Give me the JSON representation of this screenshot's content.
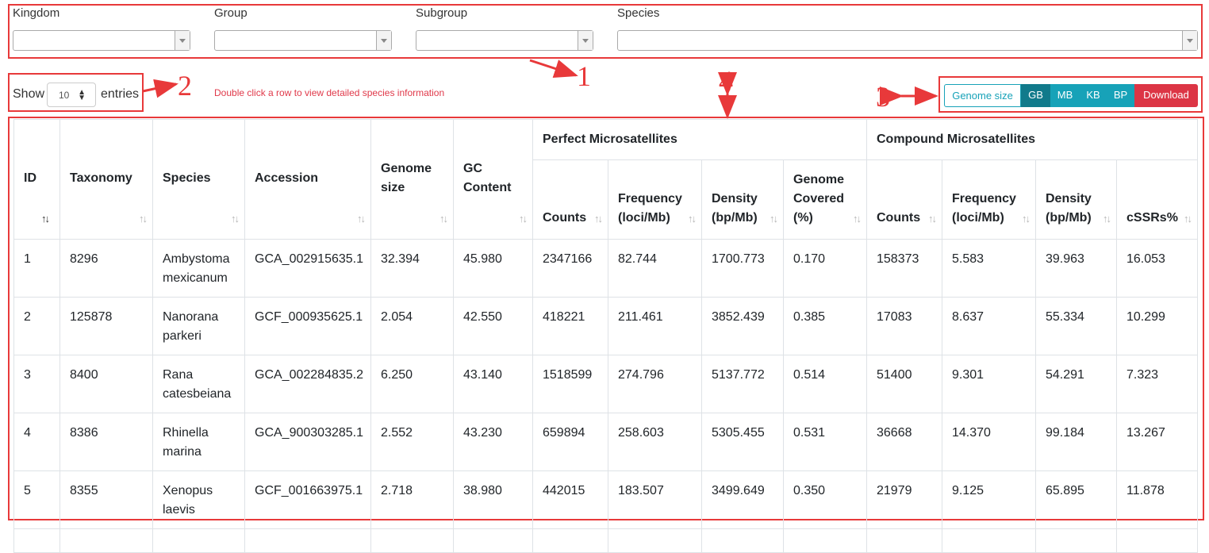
{
  "filters": {
    "kingdom_label": "Kingdom",
    "group_label": "Group",
    "subgroup_label": "Subgroup",
    "species_label": "Species"
  },
  "annotations": {
    "a1": "1",
    "a2": "2",
    "a3": "3",
    "a4": "4"
  },
  "length": {
    "show": "Show",
    "value": "10",
    "entries": "entries"
  },
  "hint": "Double click a row to view detailed species information",
  "buttons": {
    "genome_size": "Genome size",
    "gb": "GB",
    "mb": "MB",
    "kb": "KB",
    "bp": "BP",
    "download": "Download"
  },
  "table": {
    "headers": {
      "id": "ID",
      "taxonomy": "Taxonomy",
      "species": "Species",
      "accession": "Accession",
      "genome_size_1": "Genome",
      "genome_size_2": "size",
      "gc_1": "GC",
      "gc_2": "Content",
      "perfect": "Perfect Microsatellites",
      "compound": "Compound Microsatellites",
      "counts": "Counts",
      "freq_1": "Frequency",
      "freq_2": "(loci/Mb)",
      "density_1": "Density",
      "density_2": "(bp/Mb)",
      "covered_1": "Genome",
      "covered_2": "Covered",
      "covered_3": "(%)",
      "cssrs": "cSSRs%"
    },
    "rows": [
      {
        "id": "1",
        "taxonomy": "8296",
        "species_1": "Ambystoma",
        "species_2": "mexicanum",
        "accession": "GCA_002915635.1",
        "genome": "32.394",
        "gc": "45.980",
        "p_counts": "2347166",
        "p_freq": "82.744",
        "p_density": "1700.773",
        "p_cov": "0.170",
        "c_counts": "158373",
        "c_freq": "5.583",
        "c_density": "39.963",
        "c_cssr": "16.053"
      },
      {
        "id": "2",
        "taxonomy": "125878",
        "species_1": "Nanorana",
        "species_2": "parkeri",
        "accession": "GCF_000935625.1",
        "genome": "2.054",
        "gc": "42.550",
        "p_counts": "418221",
        "p_freq": "211.461",
        "p_density": "3852.439",
        "p_cov": "0.385",
        "c_counts": "17083",
        "c_freq": "8.637",
        "c_density": "55.334",
        "c_cssr": "10.299"
      },
      {
        "id": "3",
        "taxonomy": "8400",
        "species_1": "Rana",
        "species_2": "catesbeiana",
        "accession": "GCA_002284835.2",
        "genome": "6.250",
        "gc": "43.140",
        "p_counts": "1518599",
        "p_freq": "274.796",
        "p_density": "5137.772",
        "p_cov": "0.514",
        "c_counts": "51400",
        "c_freq": "9.301",
        "c_density": "54.291",
        "c_cssr": "7.323"
      },
      {
        "id": "4",
        "taxonomy": "8386",
        "species_1": "Rhinella",
        "species_2": "marina",
        "accession": "GCA_900303285.1",
        "genome": "2.552",
        "gc": "43.230",
        "p_counts": "659894",
        "p_freq": "258.603",
        "p_density": "5305.455",
        "p_cov": "0.531",
        "c_counts": "36668",
        "c_freq": "14.370",
        "c_density": "99.184",
        "c_cssr": "13.267"
      },
      {
        "id": "5",
        "taxonomy": "8355",
        "species_1": "Xenopus",
        "species_2": "laevis",
        "accession": "GCF_001663975.1",
        "genome": "2.718",
        "gc": "38.980",
        "p_counts": "442015",
        "p_freq": "183.507",
        "p_density": "3499.649",
        "p_cov": "0.350",
        "c_counts": "21979",
        "c_freq": "9.125",
        "c_density": "65.895",
        "c_cssr": "11.878"
      }
    ]
  },
  "colors": {
    "annotation": "#e8393a",
    "info": "#17a2b8",
    "info_active": "#117a8b",
    "danger": "#dc3545"
  }
}
